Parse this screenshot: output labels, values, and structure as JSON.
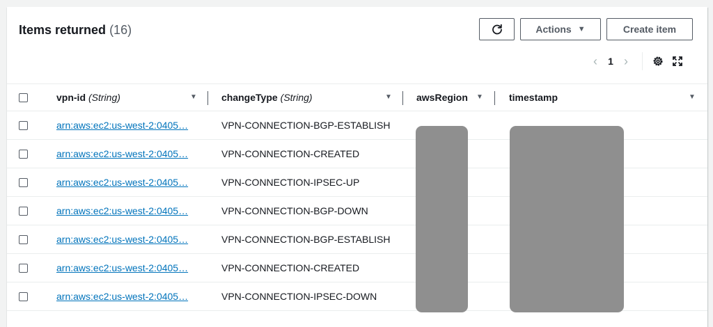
{
  "header": {
    "title": "Items returned",
    "count": "(16)",
    "refresh_icon": "refresh-icon",
    "actions_label": "Actions",
    "actions_caret": "▼",
    "create_label": "Create item"
  },
  "pagination": {
    "prev": "‹",
    "page": "1",
    "next": "›",
    "settings_icon": "gear-icon",
    "fullscreen_icon": "expand-icon"
  },
  "columns": [
    {
      "name": "vpn-id",
      "type": "(String)"
    },
    {
      "name": "changeType",
      "type": "(String)"
    },
    {
      "name": "awsRegion",
      "type": ""
    },
    {
      "name": "timestamp",
      "type": ""
    }
  ],
  "filter_glyph": "▼",
  "rows": [
    {
      "vpn_id": "arn:aws:ec2:us-west-2:0405…",
      "change_type": "VPN-CONNECTION-BGP-ESTABLISH"
    },
    {
      "vpn_id": "arn:aws:ec2:us-west-2:0405…",
      "change_type": "VPN-CONNECTION-CREATED"
    },
    {
      "vpn_id": "arn:aws:ec2:us-west-2:0405…",
      "change_type": "VPN-CONNECTION-IPSEC-UP"
    },
    {
      "vpn_id": "arn:aws:ec2:us-west-2:0405…",
      "change_type": "VPN-CONNECTION-BGP-DOWN"
    },
    {
      "vpn_id": "arn:aws:ec2:us-west-2:0405…",
      "change_type": "VPN-CONNECTION-BGP-ESTABLISH"
    },
    {
      "vpn_id": "arn:aws:ec2:us-west-2:0405…",
      "change_type": "VPN-CONNECTION-CREATED"
    },
    {
      "vpn_id": "arn:aws:ec2:us-west-2:0405…",
      "change_type": "VPN-CONNECTION-IPSEC-DOWN"
    }
  ],
  "colors": {
    "link": "#0073bb",
    "redaction": "#8f8f8f",
    "border": "#eaeded"
  }
}
